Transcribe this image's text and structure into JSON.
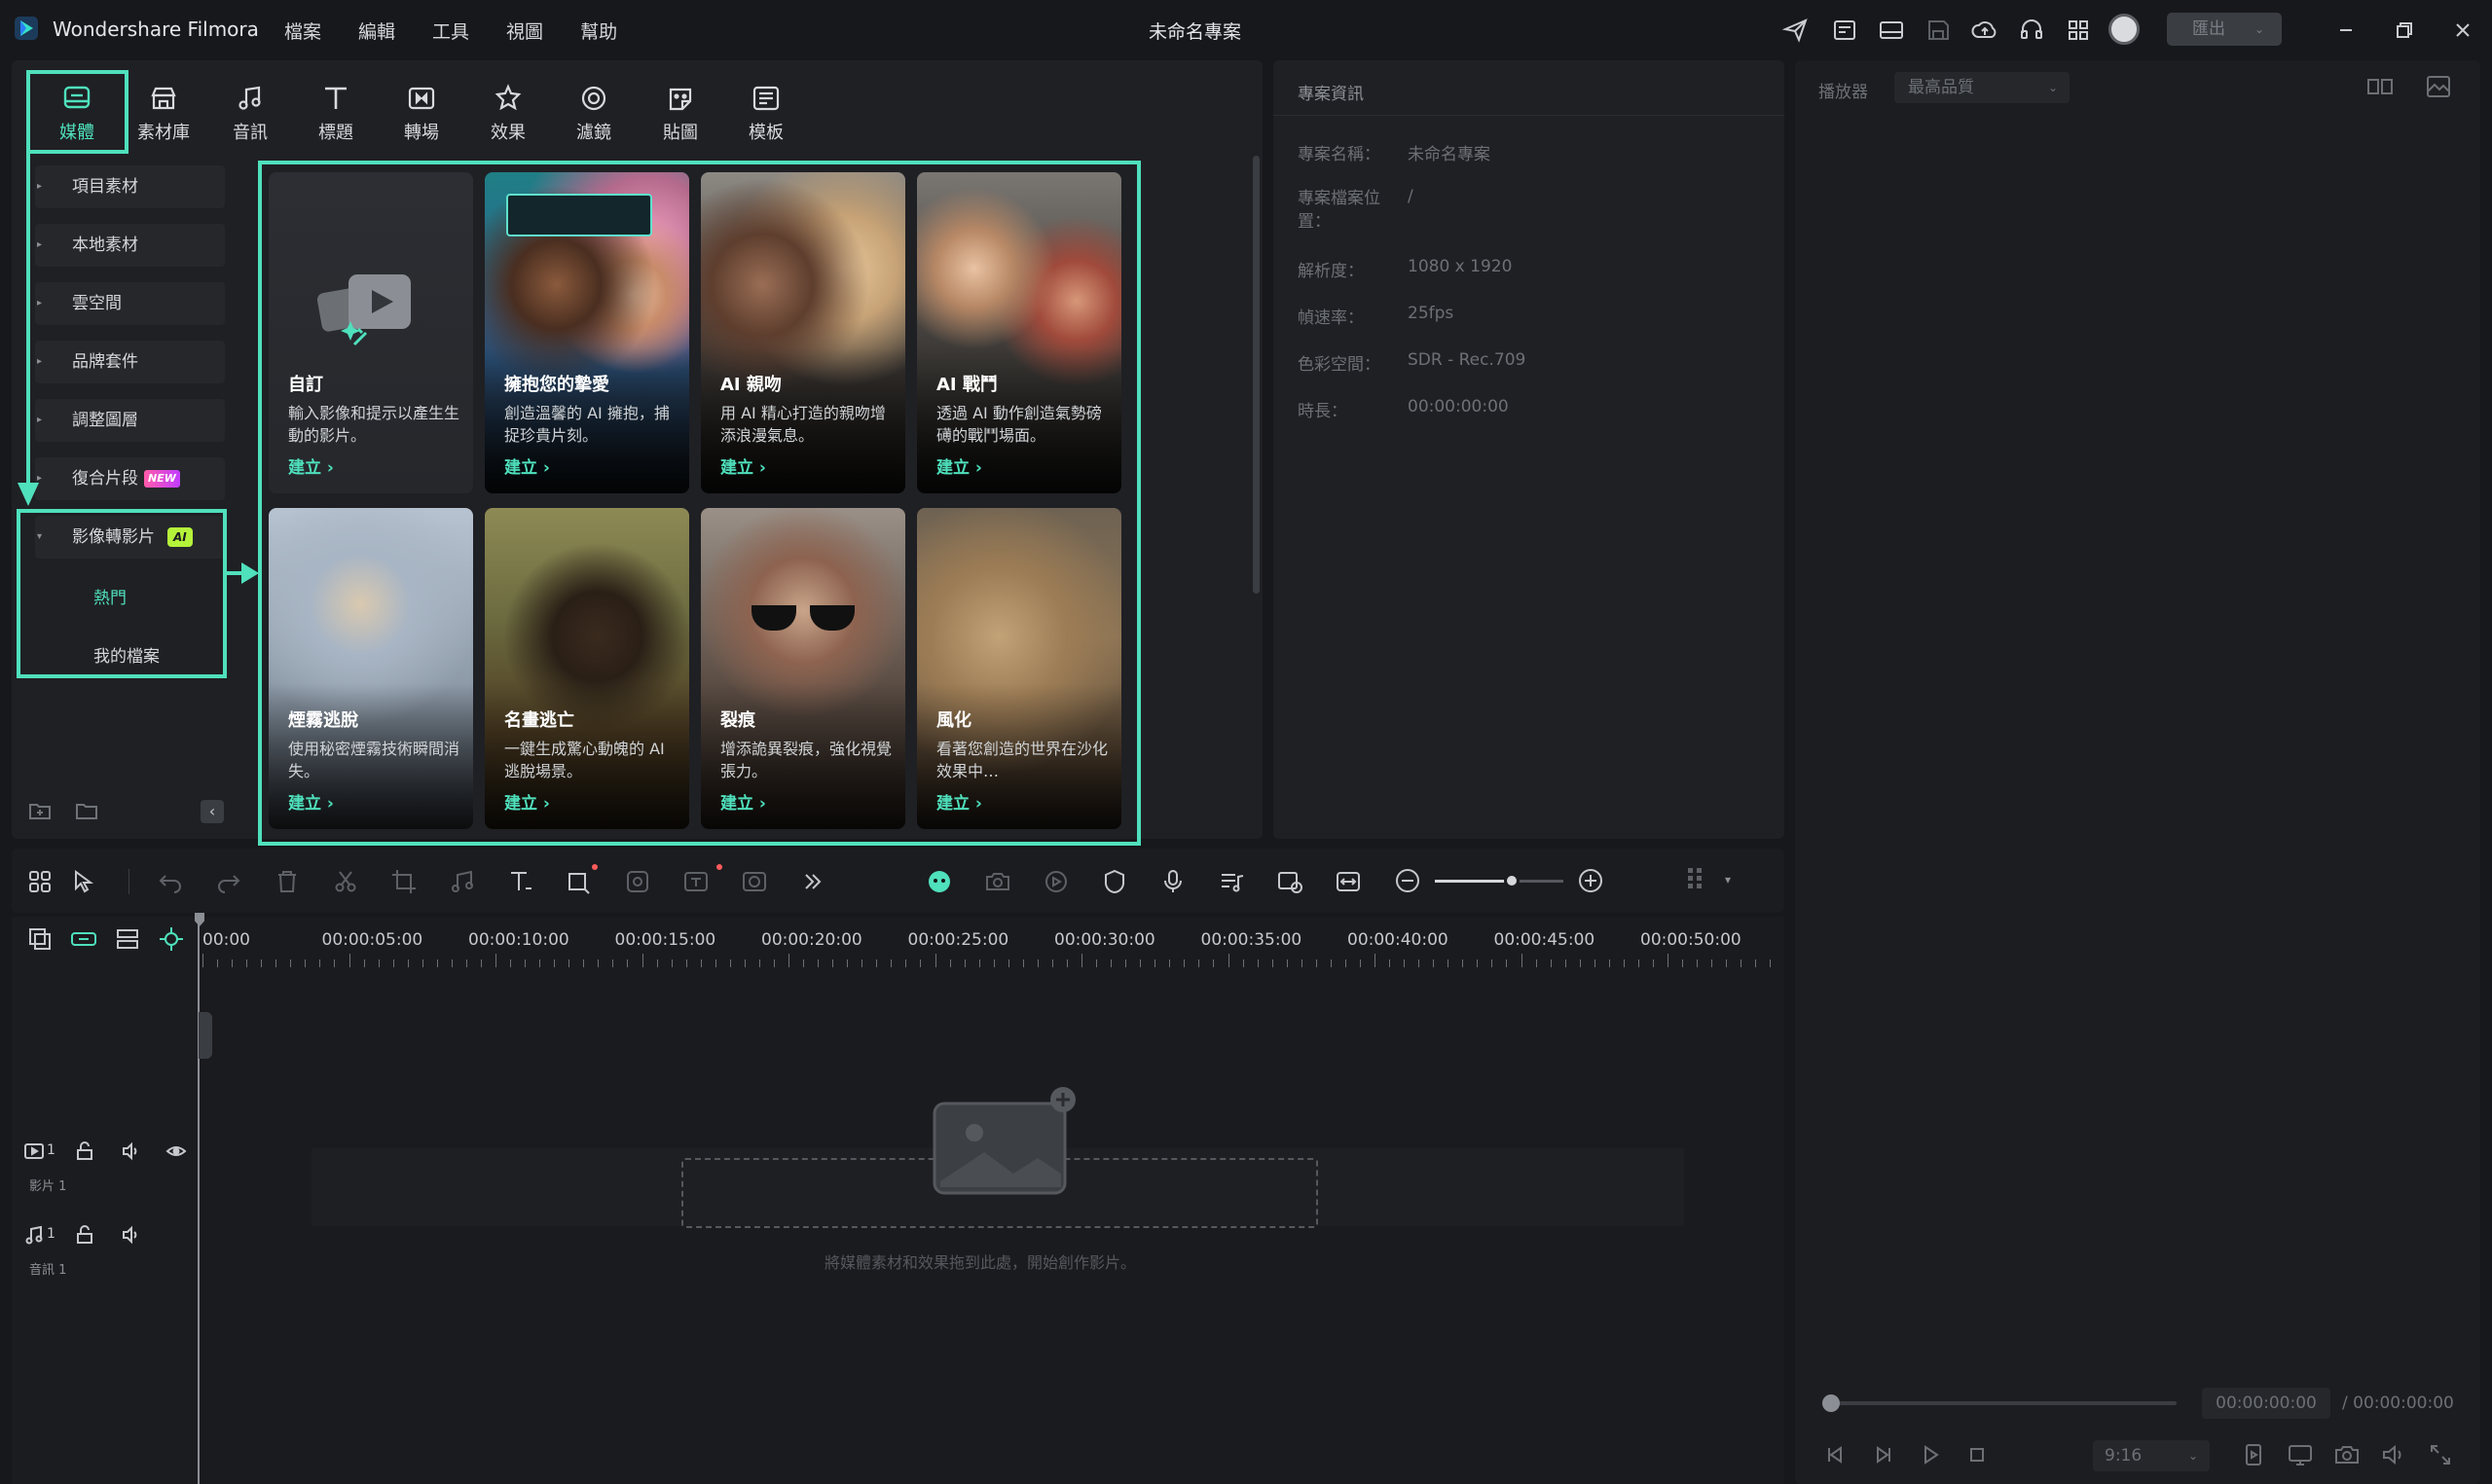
{
  "app": {
    "name": "Wondershare Filmora",
    "project_title": "未命名專案",
    "export_label": "匯出"
  },
  "menu": [
    "檔案",
    "編輯",
    "工具",
    "視圖",
    "幫助"
  ],
  "tabs": [
    {
      "label": "媒體",
      "icon": "media-icon"
    },
    {
      "label": "素材庫",
      "icon": "stock-icon"
    },
    {
      "label": "音訊",
      "icon": "audio-icon"
    },
    {
      "label": "標題",
      "icon": "title-icon"
    },
    {
      "label": "轉場",
      "icon": "transition-icon"
    },
    {
      "label": "效果",
      "icon": "effects-icon"
    },
    {
      "label": "濾鏡",
      "icon": "filter-icon"
    },
    {
      "label": "貼圖",
      "icon": "sticker-icon"
    },
    {
      "label": "模板",
      "icon": "template-icon"
    }
  ],
  "sidebar": {
    "items": [
      "項目素材",
      "本地素材",
      "雲空間",
      "品牌套件",
      "調整圖層",
      "復合片段"
    ],
    "new_badge": "NEW",
    "ai_section": "影像轉影片",
    "ai_badge": "AI",
    "sub_items": [
      "熱門",
      "我的檔案"
    ]
  },
  "cards": [
    {
      "title": "自訂",
      "desc": "輸入影像和提示以產生生動的影片。",
      "btn": "建立 ›"
    },
    {
      "title": "擁抱您的摯愛",
      "desc": "創造溫馨的 AI 擁抱，捕捉珍貴片刻。",
      "btn": "建立 ›"
    },
    {
      "title": "AI 親吻",
      "desc": "用 AI 精心打造的親吻增添浪漫氣息。",
      "btn": "建立 ›"
    },
    {
      "title": "AI 戰鬥",
      "desc": "透過 AI 動作創造氣勢磅礡的戰鬥場面。",
      "btn": "建立 ›"
    },
    {
      "title": "煙霧逃脫",
      "desc": "使用秘密煙霧技術瞬間消失。",
      "btn": "建立 ›"
    },
    {
      "title": "名畫逃亡",
      "desc": "一鍵生成驚心動魄的 AI 逃脫場景。",
      "btn": "建立 ›"
    },
    {
      "title": "裂痕",
      "desc": "增添詭異裂痕，強化視覺張力。",
      "btn": "建立 ›"
    },
    {
      "title": "風化",
      "desc": "看著您創造的世界在沙化效果中…",
      "btn": "建立 ›"
    }
  ],
  "project_info": {
    "header": "專案資訊",
    "rows": [
      {
        "label": "專案名稱：",
        "value": "未命名專案"
      },
      {
        "label": "專案檔案位置：",
        "value": "/"
      },
      {
        "label": "解析度：",
        "value": "1080 x 1920"
      },
      {
        "label": "幀速率：",
        "value": "25fps"
      },
      {
        "label": "色彩空間：",
        "value": "SDR - Rec.709"
      },
      {
        "label": "時長：",
        "value": "00:00:00:00"
      }
    ]
  },
  "player": {
    "label": "播放器",
    "quality": "最高品質",
    "current_time": "00:00:00:00",
    "total_time": "/ 00:00:00:00",
    "ratio": "9:16"
  },
  "timeline": {
    "ruler": [
      "00:00",
      "00:00:05:00",
      "00:00:10:00",
      "00:00:15:00",
      "00:00:20:00",
      "00:00:25:00",
      "00:00:30:00",
      "00:00:35:00",
      "00:00:40:00",
      "00:00:45:00",
      "00:00:50:00"
    ],
    "video_track": "影片 1",
    "audio_track": "音訊 1",
    "track_num": "1",
    "drop_hint": "將媒體素材和效果拖到此處，開始創作影片。",
    "zoom": 0.6
  },
  "colors": {
    "accent": "#4fe0bc",
    "bg": "#17181b",
    "panel": "#1f2024"
  }
}
